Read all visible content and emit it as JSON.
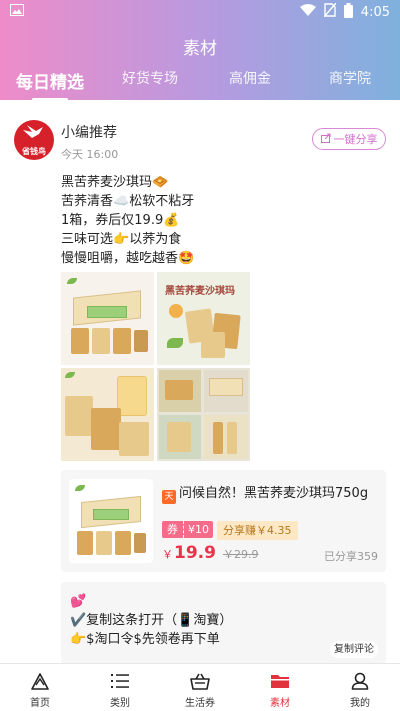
{
  "status_bar": {
    "time": "4:05",
    "icons": [
      "image-icon",
      "wifi-icon",
      "no-sim-icon",
      "battery-icon"
    ]
  },
  "header": {
    "title": "素材",
    "tabs": [
      {
        "label": "每日精选",
        "active": true
      },
      {
        "label": "好货专场",
        "active": false
      },
      {
        "label": "高佣金",
        "active": false
      },
      {
        "label": "商学院",
        "active": false
      }
    ]
  },
  "post": {
    "avatar_text": "省钱鸟",
    "author": "小编推荐",
    "time": "今天 16:00",
    "share_label": "一键分享",
    "lines": [
      {
        "text": "黑苦荞麦沙琪玛",
        "emoji": "🧇"
      },
      {
        "text": "苦荞清香",
        "emoji": "☁️",
        "text2": "松软不粘牙"
      },
      {
        "text": "1箱，券后仅19.9",
        "emoji": "💰"
      },
      {
        "text": "三味可选",
        "emoji": "👉",
        "text2": "以荞为食"
      },
      {
        "text": "慢慢咀嚼，越吃越香",
        "emoji": "🤩"
      }
    ],
    "image2_title": "黑苦荞麦沙琪玛"
  },
  "product": {
    "tag": "天",
    "title": "问候自然！黑苦荞麦沙琪玛750g",
    "coupon_prefix": "券",
    "coupon_value": "¥10",
    "earn": "分享赚￥4.35",
    "currency": "￥",
    "price": "19.9",
    "old_price": "￥29.9",
    "shared": "已分享359"
  },
  "comment": {
    "line1": "💕",
    "line2": "✔️复制这条打开（📱淘寶）",
    "line3": "👉$淘口令$先领卷再下单",
    "copy_label": "复制评论"
  },
  "navbar": {
    "items": [
      {
        "label": "首页",
        "icon": "home-triangle-icon",
        "active": false
      },
      {
        "label": "类别",
        "icon": "list-icon",
        "active": false
      },
      {
        "label": "生活券",
        "icon": "basket-icon",
        "active": false
      },
      {
        "label": "素材",
        "icon": "folder-icon",
        "active": true
      },
      {
        "label": "我的",
        "icon": "person-icon",
        "active": false
      }
    ]
  },
  "colors": {
    "accent": "#e0333e",
    "share_pink": "#d46fcd",
    "price_red": "#e8334a"
  }
}
